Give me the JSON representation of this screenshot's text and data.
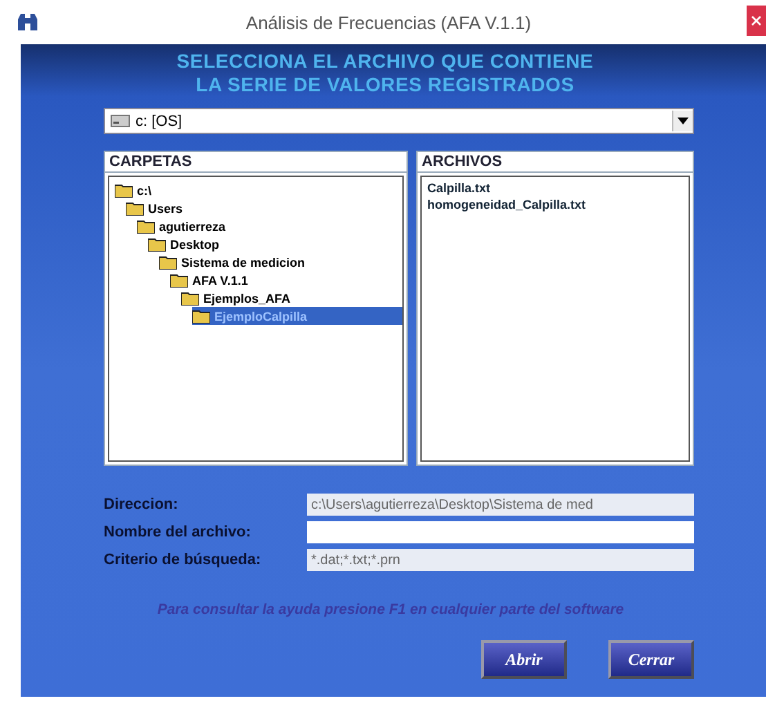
{
  "window": {
    "title": "Análisis de Frecuencias (AFA V.1.1)"
  },
  "header": [
    "SELECCIONA  EL ARCHIVO QUE CONTIENE",
    "LA SERIE DE VALORES REGISTRADOS"
  ],
  "drive": {
    "value": "c: [OS]"
  },
  "folders": {
    "title": "CARPETAS",
    "tree": [
      {
        "label": "c:\\",
        "selected": false,
        "children": [
          {
            "label": "Users",
            "selected": false,
            "children": [
              {
                "label": "agutierreza",
                "selected": false,
                "children": [
                  {
                    "label": "Desktop",
                    "selected": false,
                    "children": [
                      {
                        "label": "Sistema de medicion",
                        "selected": false,
                        "children": [
                          {
                            "label": "AFA V.1.1",
                            "selected": false,
                            "children": [
                              {
                                "label": "Ejemplos_AFA",
                                "selected": false,
                                "children": [
                                  {
                                    "label": "EjemploCalpilla",
                                    "selected": true
                                  }
                                ]
                              }
                            ]
                          }
                        ]
                      }
                    ]
                  }
                ]
              }
            ]
          }
        ]
      }
    ]
  },
  "files": {
    "title": "ARCHIVOS",
    "items": [
      {
        "label": "Calpilla.txt",
        "selected": false
      },
      {
        "label": "homogeneidad_Calpilla.txt",
        "selected": false
      }
    ]
  },
  "fields": [
    {
      "label": "Direccion:",
      "value": "c:\\Users\\agutierreza\\Desktop\\Sistema de med",
      "disabled": true
    },
    {
      "label": "Nombre del archivo:",
      "disabled": false
    },
    {
      "label": "Criterio de búsqueda:",
      "value": "*.dat;*.txt;*.prn",
      "disabled": true
    }
  ],
  "help": "Para consultar la ayuda presione F1 en cualquier parte del software",
  "buttons": [
    "Abrir",
    "Cerrar"
  ]
}
